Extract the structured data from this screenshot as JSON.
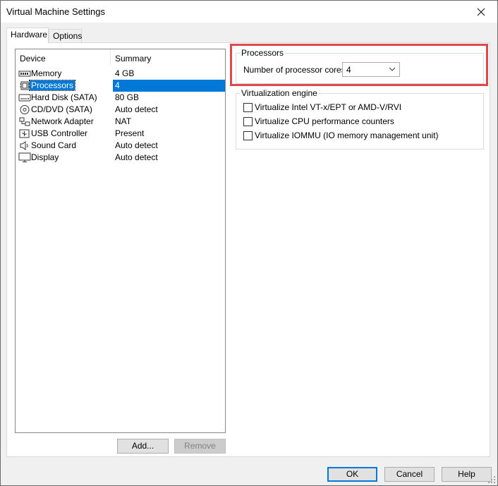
{
  "window": {
    "title": "Virtual Machine Settings"
  },
  "tabs": [
    {
      "label": "Hardware",
      "active": true
    },
    {
      "label": "Options",
      "active": false
    }
  ],
  "device_list": {
    "columns": {
      "device": "Device",
      "summary": "Summary"
    },
    "selected_index": 1,
    "rows": [
      {
        "name": "Memory",
        "summary": "4 GB",
        "icon": "memory-icon"
      },
      {
        "name": "Processors",
        "summary": "4",
        "icon": "processor-icon"
      },
      {
        "name": "Hard Disk (SATA)",
        "summary": "80 GB",
        "icon": "hard-disk-icon"
      },
      {
        "name": "CD/DVD (SATA)",
        "summary": "Auto detect",
        "icon": "cd-dvd-icon"
      },
      {
        "name": "Network Adapter",
        "summary": "NAT",
        "icon": "network-adapter-icon"
      },
      {
        "name": "USB Controller",
        "summary": "Present",
        "icon": "usb-icon"
      },
      {
        "name": "Sound Card",
        "summary": "Auto detect",
        "icon": "speaker-icon"
      },
      {
        "name": "Display",
        "summary": "Auto detect",
        "icon": "monitor-icon"
      }
    ]
  },
  "list_buttons": {
    "add": "Add...",
    "remove": "Remove"
  },
  "processors": {
    "group_title": "Processors",
    "cores_label": "Number of processor cores:",
    "cores_value": "4"
  },
  "virtualization": {
    "group_title": "Virtualization engine",
    "options": [
      {
        "label": "Virtualize Intel VT-x/EPT or AMD-V/RVI",
        "checked": false
      },
      {
        "label": "Virtualize CPU performance counters",
        "checked": false
      },
      {
        "label": "Virtualize IOMMU (IO memory management unit)",
        "checked": false
      }
    ]
  },
  "dialog_buttons": {
    "ok": "OK",
    "cancel": "Cancel",
    "help": "Help"
  },
  "colors": {
    "selection": "#0078d7",
    "highlight_border": "#e0484f"
  }
}
